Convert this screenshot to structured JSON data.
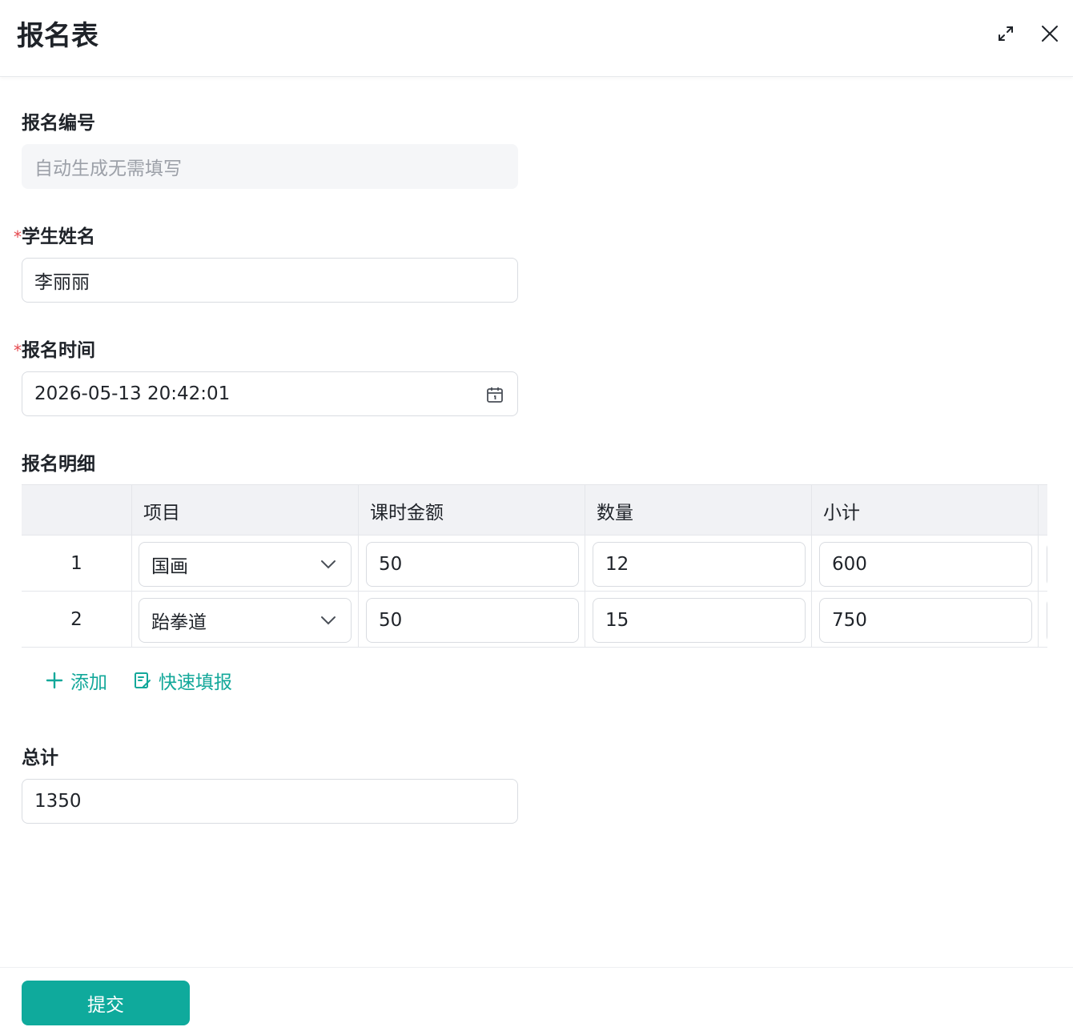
{
  "dialog": {
    "title": "报名表"
  },
  "fields": {
    "number": {
      "label": "报名编号",
      "placeholder": "自动生成无需填写"
    },
    "student": {
      "label": "学生姓名",
      "required_mark": "*",
      "value": "李丽丽"
    },
    "time": {
      "label": "报名时间",
      "required_mark": "*",
      "value": "2026-05-13 20:42:01"
    },
    "details": {
      "label": "报名明细"
    },
    "total": {
      "label": "总计",
      "value": "1350"
    }
  },
  "table": {
    "headers": [
      "",
      "项目",
      "课时金额",
      "数量",
      "小计"
    ],
    "rows": [
      {
        "index": "1",
        "item": "国画",
        "price": "50",
        "qty": "12",
        "subtotal": "600"
      },
      {
        "index": "2",
        "item": "跆拳道",
        "price": "50",
        "qty": "15",
        "subtotal": "750"
      }
    ]
  },
  "actions": {
    "add": "添加",
    "quick_fill": "快速填报"
  },
  "submit": {
    "label": "提交"
  },
  "colors": {
    "accent": "#0faa9c",
    "required": "#e5484d"
  }
}
